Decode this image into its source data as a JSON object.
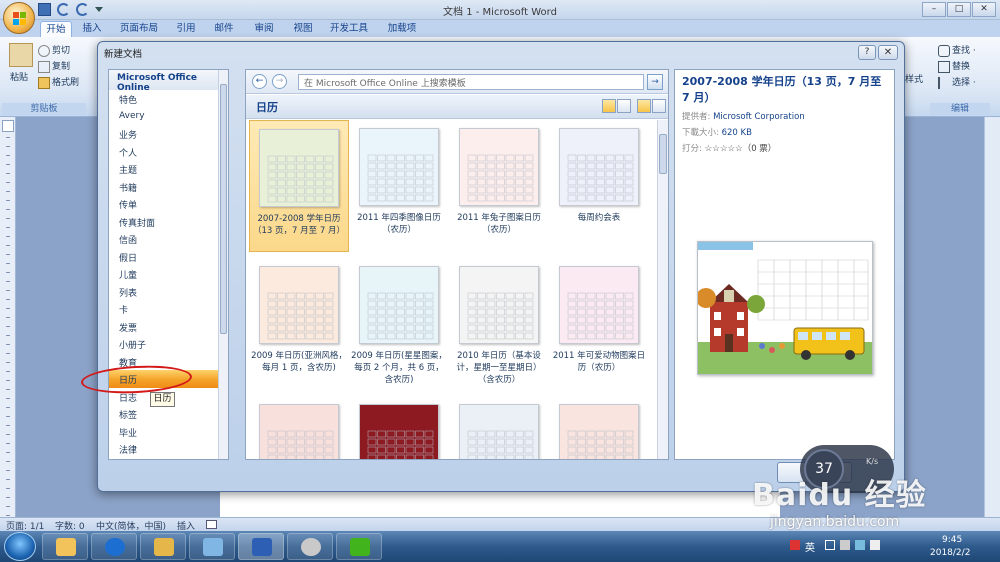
{
  "window": {
    "title": "文档 1 - Microsoft Word",
    "controls": [
      "–",
      "□",
      "✕"
    ]
  },
  "ribbon": {
    "tabs": [
      "开始",
      "插入",
      "页面布局",
      "引用",
      "邮件",
      "审阅",
      "视图",
      "开发工具",
      "加载项"
    ],
    "clipboard": {
      "paste": "粘贴",
      "cut": "剪切",
      "copy": "复制",
      "format_painter": "格式刷",
      "group": "剪贴板"
    },
    "editing": {
      "find": "查找 ·",
      "replace": "替换",
      "select": "选择 ·",
      "group": "编辑",
      "styles_cut": "样式"
    }
  },
  "dialog": {
    "title": "新建文档",
    "help": "?",
    "close": "✕",
    "categories_header": "Microsoft Office Online",
    "categories": [
      "特色",
      "Avery",
      "业务",
      "个人",
      "主题",
      "书籍",
      "传单",
      "传真封面",
      "信函",
      "假日",
      "儿童",
      "列表",
      "卡",
      "发票",
      "小册子",
      "教育",
      "日历",
      "日志",
      "标签",
      "毕业",
      "法律"
    ],
    "selected_category": "日历",
    "tooltip": "日历",
    "search_placeholder": "在 Microsoft Office Online 上搜索模板",
    "gallery_title": "日历",
    "templates": [
      {
        "caption": "2007-2008 学年日历（13 页，7 月至 7 月）"
      },
      {
        "caption": "2011 年四季图像日历（农历）"
      },
      {
        "caption": "2011 年兔子图案日历（农历）"
      },
      {
        "caption": "每周约会表"
      },
      {
        "caption": "2009 年日历(亚洲风格，每月 1 页，含农历)"
      },
      {
        "caption": "2009 年日历(星星图案，每页 2 个月，共 6 页，含农历)"
      },
      {
        "caption": "2010 年日历（基本设计，星期一至星期日）（含农历）"
      },
      {
        "caption": "2011 年可爱动物图案日历（农历）"
      },
      {
        "caption": ""
      },
      {
        "caption": ""
      },
      {
        "caption": ""
      },
      {
        "caption": ""
      }
    ],
    "preview": {
      "title": "2007-2008 学年日历（13 页，7 月至 7 月）",
      "provider_label": "提供者:",
      "provider": "Microsoft Corporation",
      "size_label": "下載大小:",
      "size": "620 KB",
      "rating_label": "打分:",
      "stars": "☆☆☆☆☆",
      "votes": "（0 票）"
    },
    "download_button": "下",
    "overlay_count": "37",
    "overlay_text": "K/s"
  },
  "statusbar": {
    "page": "页面: 1/1",
    "words": "字数: 0",
    "language": "中文(简体，中国)",
    "insert": "插入"
  },
  "taskbar": {
    "ime": "英",
    "time": "9:45",
    "date": "2018/2/2"
  },
  "watermark": {
    "brand": "Baidu 经验",
    "url": "jingyan.baidu.com"
  },
  "colors": {
    "selection_orange": "#f4a228",
    "accent_blue": "#15428b",
    "annotation_red": "#d31a1a"
  }
}
